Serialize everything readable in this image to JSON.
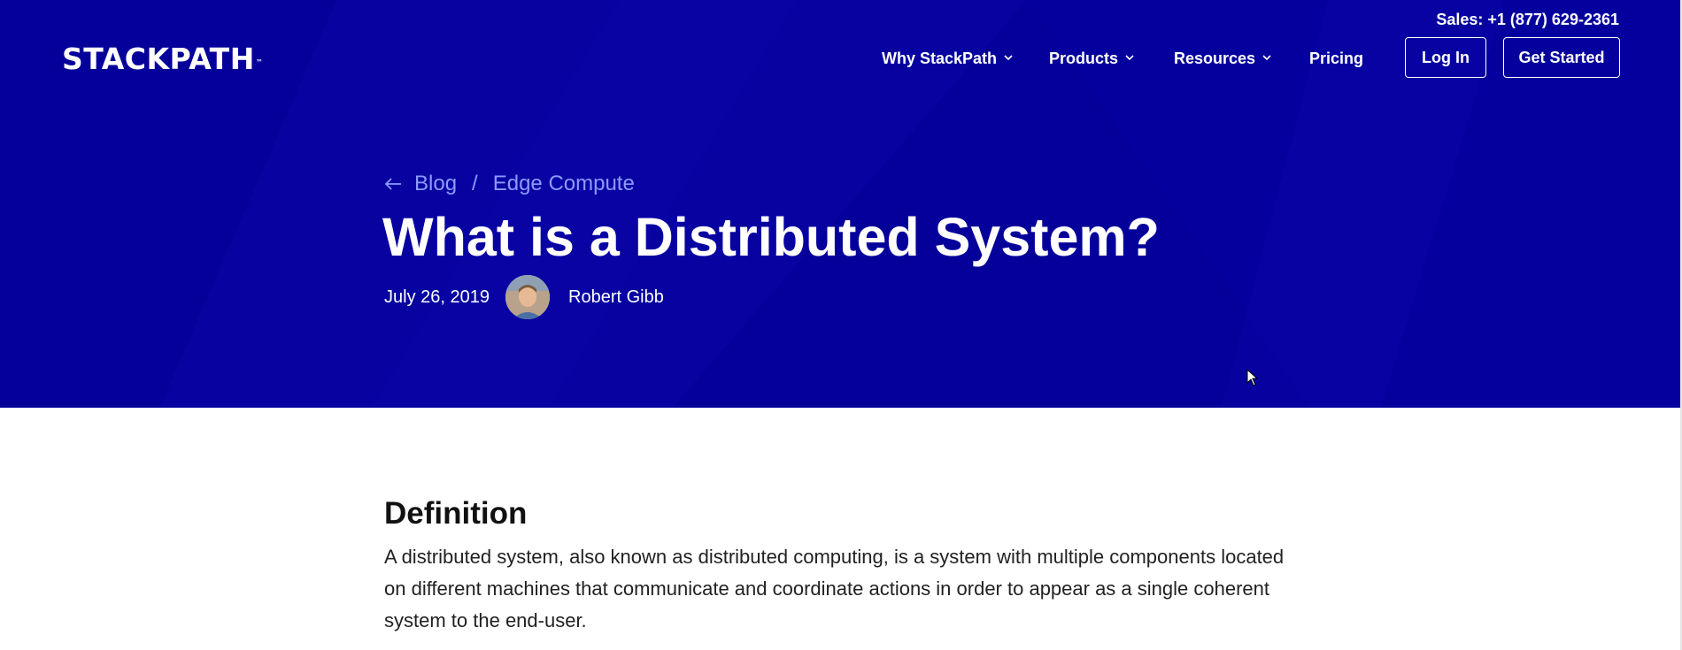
{
  "header": {
    "logo_text": "STACKPATH",
    "logo_tm": "™",
    "sales": "Sales: +1 (877) 629-2361",
    "nav": [
      {
        "label": "Why StackPath",
        "has_dropdown": true
      },
      {
        "label": "Products",
        "has_dropdown": true
      },
      {
        "label": "Resources",
        "has_dropdown": true
      },
      {
        "label": "Pricing",
        "has_dropdown": false
      }
    ],
    "login_label": "Log In",
    "get_started_label": "Get Started"
  },
  "hero": {
    "breadcrumb": [
      "Blog",
      "/",
      "Edge Compute"
    ],
    "title": "What is a Distributed System?",
    "date": "July 26, 2019",
    "author": "Robert Gibb"
  },
  "article": {
    "heading": "Definition",
    "paragraph": "A distributed system, also known as distributed computing, is a system with multiple components located on different machines that communicate and coordinate actions in order to appear as a single coherent system to the end-user."
  },
  "colors": {
    "hero_bg": "#06009a",
    "breadcrumb": "#8d9aff",
    "text_dark": "#111111"
  },
  "icons": [
    "arrow-left-icon",
    "chevron-down-icon",
    "author-avatar",
    "mouse-cursor-icon"
  ]
}
